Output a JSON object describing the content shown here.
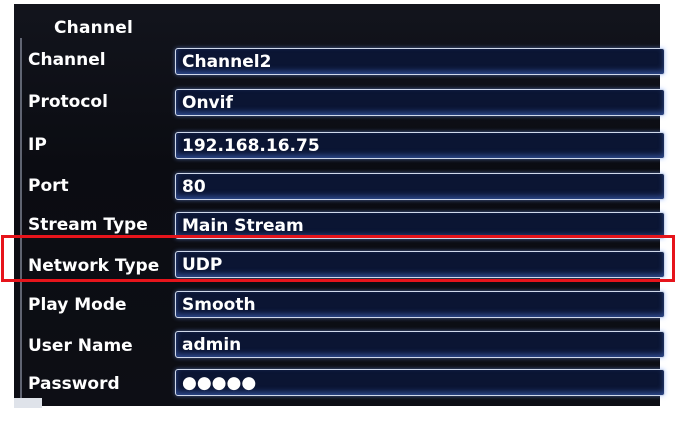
{
  "panel": {
    "title": "Channel"
  },
  "rows": [
    {
      "label": "Channel",
      "value": "Channel2"
    },
    {
      "label": "Protocol",
      "value": "Onvif"
    },
    {
      "label": "IP",
      "value": "192.168.16.75"
    },
    {
      "label": "Port",
      "value": "80"
    },
    {
      "label": "Stream Type",
      "value": "Main Stream"
    },
    {
      "label": "Network Type",
      "value": "UDP"
    },
    {
      "label": "Play Mode",
      "value": "Smooth"
    },
    {
      "label": "User Name",
      "value": "admin"
    },
    {
      "label": "Password",
      "value": "●●●●●"
    }
  ],
  "colors": {
    "highlight": "#e6141b",
    "field_background": "#0b1533",
    "screen_background": "#0b0c12"
  }
}
